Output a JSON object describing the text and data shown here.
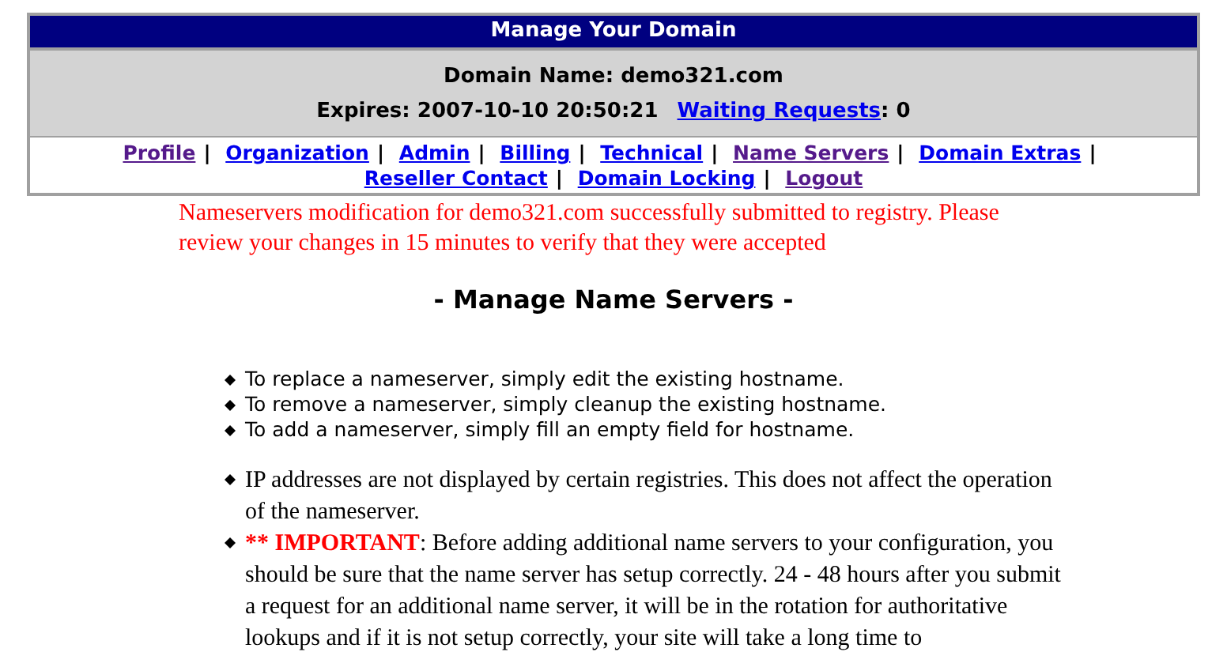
{
  "panel": {
    "title": "Manage Your Domain",
    "domain_label": "Domain Name:",
    "domain": "demo321.com",
    "expires_label": "Expires:",
    "expires": "2007-10-10 20:50:21",
    "waiting_link": "Waiting Requests",
    "waiting_count": ": 0"
  },
  "nav": {
    "links": [
      {
        "label": "Profile",
        "visited": true,
        "separator": "|"
      },
      {
        "label": "Organization",
        "visited": false,
        "separator": "|"
      },
      {
        "label": "Admin",
        "visited": false,
        "separator": "|"
      },
      {
        "label": "Billing",
        "visited": false,
        "separator": "|"
      },
      {
        "label": "Technical",
        "visited": false,
        "separator": "|"
      },
      {
        "label": "Name Servers",
        "visited": true,
        "separator": "|"
      },
      {
        "label": "Domain Extras",
        "visited": false,
        "separator": "|"
      },
      {
        "label": "Reseller Contact",
        "visited": false,
        "separator": "|"
      },
      {
        "label": "Domain Locking",
        "visited": false,
        "separator": "|"
      },
      {
        "label": "Logout",
        "visited": true
      }
    ]
  },
  "message": "Nameservers modification for demo321.com successfully submitted to registry. Please review your changes in 15 minutes to verify that they were accepted",
  "heading": "- Manage Name Servers -",
  "tips": [
    "To replace a nameserver, simply edit the existing hostname.",
    "To remove a nameserver, simply cleanup the existing hostname.",
    "To add a nameserver, simply fill an empty field for hostname."
  ],
  "notes": [
    {
      "kind": "plain",
      "text": "IP addresses are not displayed by certain registries. This does not affect the operation of the nameserver."
    },
    {
      "kind": "important",
      "lead": "** IMPORTANT",
      "text": ": Before adding additional name servers to your configuration, you should be sure that the name server has setup correctly. 24 - 48 hours after you submit a request for an additional name server, it will be in the rotation for authoritative lookups and if it is not setup correctly, your site will take a long time to"
    }
  ]
}
